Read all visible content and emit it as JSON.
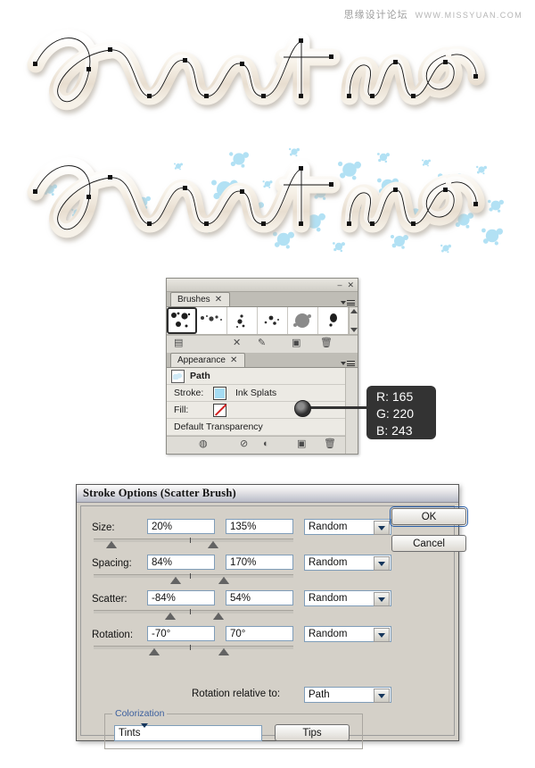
{
  "watermark": {
    "cn": "思缘设计论坛",
    "url": "WWW.MISSYUAN.COM"
  },
  "artwork": {
    "text_top": "Paint me",
    "text_bottom": "Paint me",
    "splat_color": "#A5DCF3",
    "letter_color": "#F2EDE4"
  },
  "brushes_panel": {
    "tab_label": "Brushes",
    "close_glyph": "✕",
    "minimize_glyph": "–",
    "panel_close_glyph": "✕",
    "brush_count": 6,
    "selected_index": 0,
    "footer_icons": [
      "brush-libraries-icon",
      "remove-brush-stroke-icon",
      "options-of-selected-object-icon",
      "new-brush-icon",
      "delete-brush-icon"
    ]
  },
  "appearance_panel": {
    "tab_label": "Appearance",
    "close_glyph": "✕",
    "target_label": "Path",
    "stroke_label": "Stroke:",
    "stroke_value": "Ink Splats",
    "fill_label": "Fill:",
    "fill_value": "",
    "transparency_label": "Default Transparency",
    "footer_icons": [
      "opacity-toggle-icon",
      "clear-appearance-icon",
      "reduce-to-basic-appearance-icon",
      "duplicate-item-icon",
      "delete-item-icon"
    ]
  },
  "color_tooltip": {
    "r": "R: 165",
    "g": "G: 220",
    "b": "B: 243",
    "hex": "#A5DCF3"
  },
  "dialog": {
    "title": "Stroke Options (Scatter Brush)",
    "rows": [
      {
        "label": "Size:",
        "min": "20%",
        "max": "135%",
        "mode": "Random",
        "h1": 14,
        "h2": 56
      },
      {
        "label": "Spacing:",
        "min": "84%",
        "max": "170%",
        "mode": "Random",
        "h1": 44,
        "h2": 78
      },
      {
        "label": "Scatter:",
        "min": "-84%",
        "max": "54%",
        "mode": "Random",
        "h1": 42,
        "h2": 62
      },
      {
        "label": "Rotation:",
        "min": "-70°",
        "max": "70°",
        "mode": "Random",
        "h1": 30,
        "h2": 72
      }
    ],
    "rotation_relative_label": "Rotation relative to:",
    "rotation_relative_value": "Path",
    "colorization_legend": "Colorization",
    "colorization_value": "Tints",
    "tips_button": "Tips",
    "ok_button": "OK",
    "cancel_button": "Cancel"
  }
}
